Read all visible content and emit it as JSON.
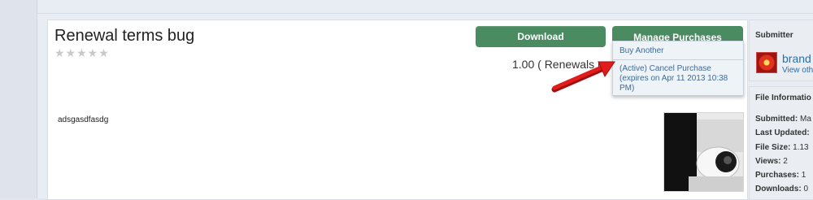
{
  "file": {
    "title": "Renewal terms bug",
    "rating_stars": "★★★★★",
    "price_text": "1.00 ( Renewals re",
    "description": "adsgasdfasdg"
  },
  "buttons": {
    "download": "Download",
    "manage_purchases": "Manage Purchases"
  },
  "dropdown": {
    "buy_another": "Buy Another",
    "cancel_purchase": "(Active) Cancel Purchase (expires on Apr 11 2013 10:38 PM)"
  },
  "sidebar": {
    "submitter": {
      "heading": "Submitter",
      "name": "brand",
      "view_link": "View oth"
    },
    "file_info": {
      "heading": "File Informatio",
      "rows": [
        {
          "label": "Submitted:",
          "value": "Ma"
        },
        {
          "label": "Last Updated:",
          "value": ""
        },
        {
          "label": "File Size:",
          "value": "1.13"
        },
        {
          "label": "Views:",
          "value": "2"
        },
        {
          "label": "Purchases:",
          "value": "1"
        },
        {
          "label": "Downloads:",
          "value": "0"
        }
      ]
    }
  },
  "colors": {
    "accent_green": "#4b8b61",
    "link_blue": "#2c6ea6",
    "arrow_red": "#e21b1b"
  }
}
